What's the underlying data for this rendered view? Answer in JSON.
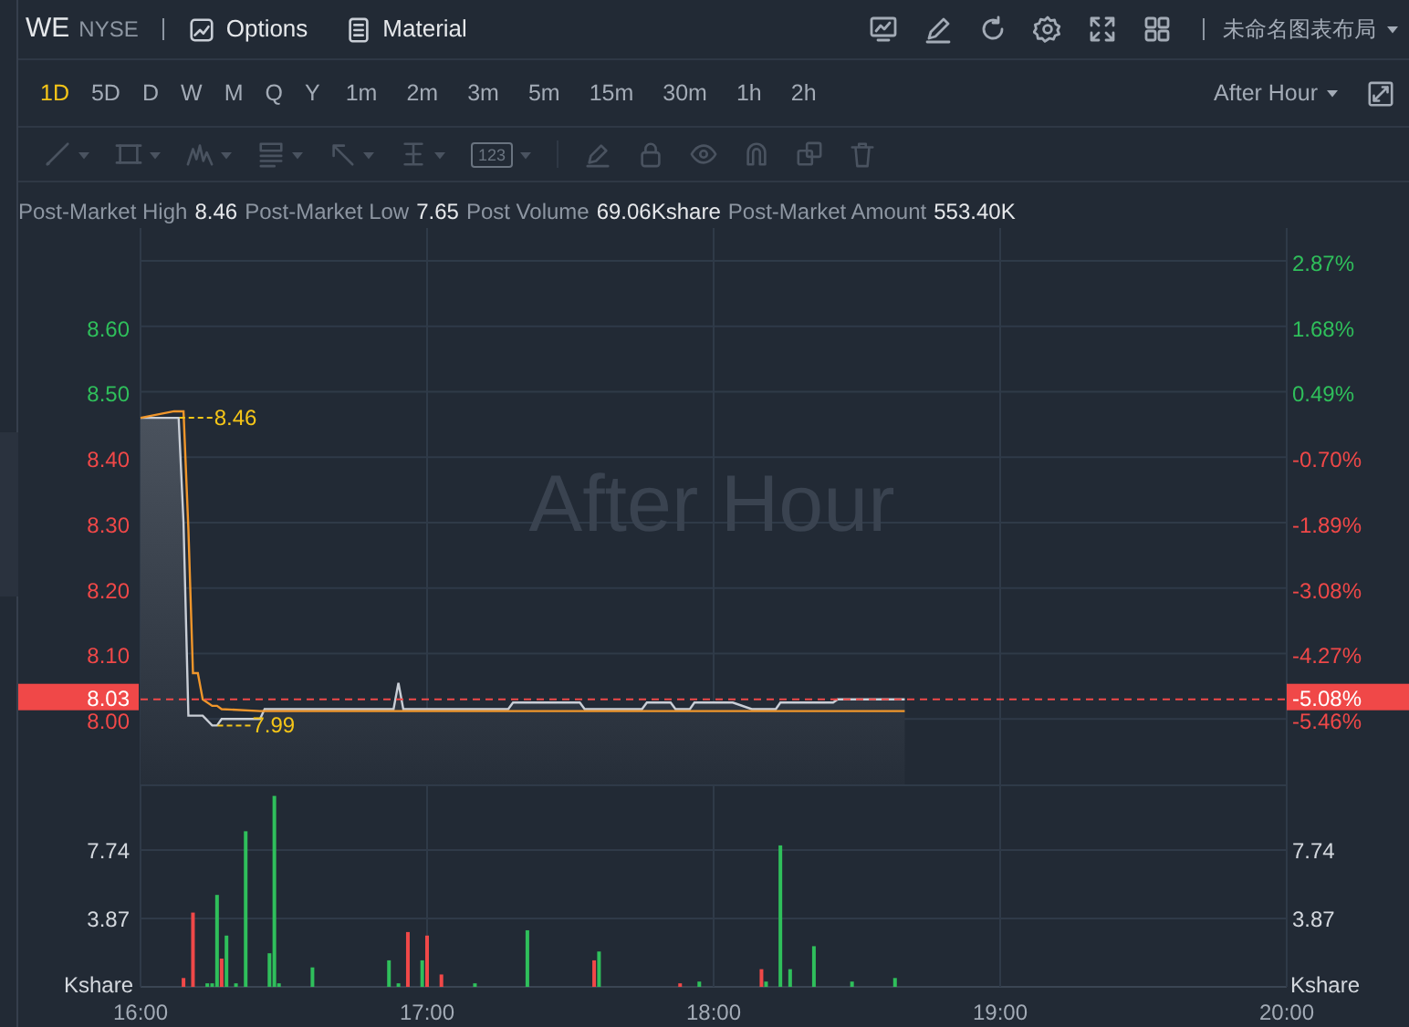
{
  "header": {
    "symbol": "WE",
    "exchange": "NYSE",
    "buttons": [
      {
        "kind": "options",
        "label": "Options"
      },
      {
        "kind": "material",
        "label": "Material"
      }
    ],
    "tools": [
      {
        "kind": "chart"
      },
      {
        "kind": "pencil"
      },
      {
        "kind": "refresh"
      },
      {
        "kind": "settings"
      },
      {
        "kind": "fullscreen"
      },
      {
        "kind": "grid"
      }
    ],
    "layout_name": "未命名图表布局"
  },
  "timeframes": [
    {
      "label": "1D",
      "selected": true
    },
    {
      "label": "5D",
      "selected": false
    },
    {
      "label": "D",
      "selected": false
    },
    {
      "label": "W",
      "selected": false
    },
    {
      "label": "M",
      "selected": false
    },
    {
      "label": "Q",
      "selected": false
    },
    {
      "label": "Y",
      "selected": false
    },
    {
      "label": "1m",
      "selected": false
    },
    {
      "label": "2m",
      "selected": false
    },
    {
      "label": "3m",
      "selected": false
    },
    {
      "label": "5m",
      "selected": false
    },
    {
      "label": "15m",
      "selected": false
    },
    {
      "label": "30m",
      "selected": false
    },
    {
      "label": "1h",
      "selected": false
    },
    {
      "label": "2h",
      "selected": false
    }
  ],
  "session_dropdown": "After Hour",
  "drawing_tools": [
    {
      "kind": "line",
      "disabled": true
    },
    {
      "kind": "rectangle",
      "disabled": true
    },
    {
      "kind": "pattern",
      "disabled": true
    },
    {
      "kind": "text-list",
      "disabled": true
    },
    {
      "kind": "arrow",
      "disabled": true
    },
    {
      "kind": "measure",
      "disabled": true
    },
    {
      "kind": "label",
      "label": "123",
      "disabled": true
    },
    {
      "kind": "pen",
      "disabled": true
    },
    {
      "kind": "lock",
      "disabled": true
    },
    {
      "kind": "eye",
      "disabled": true
    },
    {
      "kind": "magnet",
      "disabled": true
    },
    {
      "kind": "clone",
      "disabled": true
    },
    {
      "kind": "trash",
      "disabled": true
    }
  ],
  "stats": [
    {
      "label": "Post-Market High",
      "value": "8.46"
    },
    {
      "label": "Post-Market Low",
      "value": "7.65"
    },
    {
      "label": "Post Volume",
      "value": "69.06Kshare"
    },
    {
      "label": "Post-Market Amount",
      "value": "553.40K"
    }
  ],
  "price_panel": {
    "watermark": "After Hour",
    "chart_data": {
      "type": "line",
      "x": [
        16,
        16.117,
        16.133,
        16.15,
        16.167,
        16.183,
        16.2,
        16.217,
        16.25,
        16.267,
        16.283,
        16.417,
        16.433,
        16.883,
        16.9,
        16.917,
        17.283,
        17.3,
        17.533,
        17.55,
        17.75,
        17.767,
        17.85,
        17.867,
        17.917,
        17.933,
        18.067,
        18.133,
        18.217,
        18.233,
        18.417,
        18.433,
        18.667
      ],
      "series": [
        {
          "color": "#c9ced6",
          "values": [
            8.46,
            8.46,
            8.46,
            8.3,
            8.005,
            8.005,
            8.005,
            8.005,
            7.99,
            7.99,
            8.0,
            8.0,
            8.015,
            8.015,
            8.055,
            8.015,
            8.015,
            8.025,
            8.025,
            8.015,
            8.015,
            8.025,
            8.025,
            8.015,
            8.015,
            8.025,
            8.025,
            8.015,
            8.015,
            8.025,
            8.025,
            8.03,
            8.03
          ]
        },
        {
          "color": "#f0962b",
          "values": [
            8.46,
            8.47,
            8.47,
            8.47,
            8.29,
            8.07,
            8.07,
            8.03,
            8.02,
            8.02,
            8.015,
            8.012,
            8.012,
            8.012,
            8.012,
            8.012,
            8.012,
            8.012,
            8.012,
            8.012,
            8.012,
            8.012,
            8.012,
            8.012,
            8.012,
            8.012,
            8.012,
            8.012,
            8.012,
            8.012,
            8.012,
            8.012,
            8.012
          ]
        }
      ],
      "xlim": [
        16,
        20
      ],
      "ylim": [
        7.9,
        8.75
      ],
      "grid": true,
      "ref_lines": [
        {
          "axis": "y",
          "value": 8.03,
          "color": "#f04848"
        }
      ],
      "yticks": [
        {
          "value": 8.6,
          "label": "8.60"
        },
        {
          "value": 8.5,
          "label": "8.50"
        },
        {
          "value": 8.4,
          "label": "8.40"
        },
        {
          "value": 8.3,
          "label": "8.30"
        },
        {
          "value": 8.2,
          "label": "8.20"
        },
        {
          "value": 8.1,
          "label": "8.10"
        },
        {
          "value": 8.0,
          "label": "8.00"
        }
      ],
      "annotations": [
        {
          "x": 16.117,
          "y": 8.46,
          "text": "8.46"
        },
        {
          "x": 16.25,
          "y": 7.99,
          "text": "7.99"
        }
      ]
    },
    "right_axis": [
      {
        "label": "2.87%",
        "color": "#2fbf5b"
      },
      {
        "label": "1.68%",
        "color": "#2fbf5b"
      },
      {
        "label": "0.49%",
        "color": "#2fbf5b"
      },
      {
        "label": "-0.70%",
        "color": "#f04848"
      },
      {
        "label": "-1.89%",
        "color": "#f04848"
      },
      {
        "label": "-3.08%",
        "color": "#f04848"
      },
      {
        "label": "-4.27%",
        "color": "#f04848"
      },
      {
        "label": "-5.46%",
        "color": "#f04848"
      }
    ],
    "last_price": {
      "price": "8.03",
      "change": "-5.08%"
    }
  },
  "volume_panel": {
    "unit_labels": [
      "Kshare",
      "Kshare"
    ],
    "right_axis": [
      "7.74",
      "3.87"
    ],
    "chart_data": {
      "type": "bar",
      "grid": true,
      "x": [
        16.15,
        16.183,
        16.233,
        16.25,
        16.267,
        16.283,
        16.3,
        16.333,
        16.367,
        16.45,
        16.467,
        16.483,
        16.6,
        16.867,
        16.9,
        16.933,
        16.983,
        17,
        17.05,
        17.167,
        17.35,
        17.583,
        17.6,
        17.883,
        17.95,
        18.167,
        18.183,
        18.233,
        18.267,
        18.35,
        18.483,
        18.633
      ],
      "series": [
        {
          "color": "#2fbf5b",
          "values": [
            null,
            null,
            0.2,
            0.2,
            5.2,
            null,
            2.9,
            0.2,
            8.8,
            1.9,
            10.8,
            0.2,
            1.1,
            1.5,
            0.2,
            null,
            1.5,
            null,
            null,
            0.2,
            3.2,
            null,
            2.0,
            null,
            0.3,
            null,
            0.3,
            8.0,
            1.0,
            2.3,
            0.3,
            0.5
          ]
        },
        {
          "color": "#f04848",
          "values": [
            0.5,
            4.2,
            null,
            null,
            null,
            1.6,
            null,
            null,
            null,
            null,
            null,
            null,
            null,
            null,
            null,
            3.1,
            null,
            2.9,
            0.7,
            null,
            null,
            1.5,
            null,
            0.2,
            null,
            1.0,
            null,
            null,
            null,
            null,
            null,
            null
          ]
        }
      ],
      "xlim": [
        16,
        20
      ],
      "ylim": [
        0,
        11.45
      ],
      "yticks": [
        {
          "value": 7.74,
          "label": "7.74"
        },
        {
          "value": 3.87,
          "label": "3.87"
        }
      ],
      "xticks": [
        {
          "value": 16,
          "label": "16:00"
        },
        {
          "value": 17,
          "label": "17:00"
        },
        {
          "value": 18,
          "label": "18:00"
        },
        {
          "value": 19,
          "label": "19:00"
        },
        {
          "value": 20,
          "label": "20:00"
        }
      ]
    }
  }
}
